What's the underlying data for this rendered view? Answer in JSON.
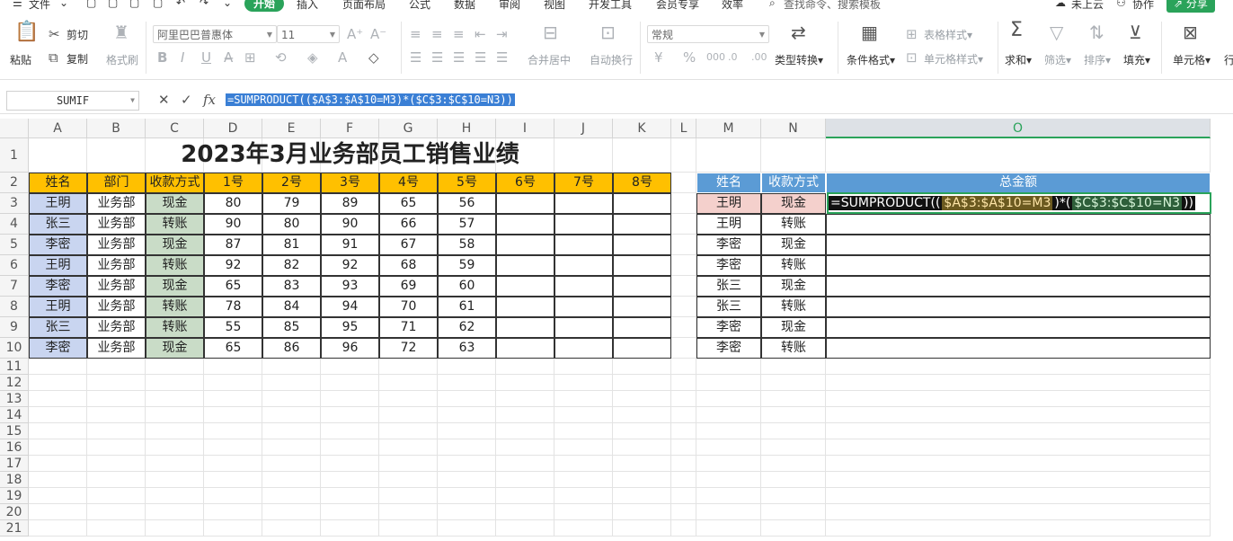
{
  "menubar": {
    "file": "文件",
    "tabs": [
      "开始",
      "插入",
      "页面布局",
      "公式",
      "数据",
      "审阅",
      "视图",
      "开发工具",
      "会员专享",
      "效率"
    ],
    "active_tab": "开始",
    "search_placeholder": "查找命令、搜索模板",
    "cloud": "未上云",
    "collab": "协作",
    "share": "分享"
  },
  "ribbon": {
    "paste": "粘贴",
    "cut": "剪切",
    "copy": "复制",
    "format_painter": "格式刷",
    "font_name": "阿里巴巴普惠体",
    "font_size": "11",
    "merge_center": "合并居中",
    "auto_wrap": "自动换行",
    "number_format": "常规",
    "type_convert": "类型转换",
    "cond_format": "条件格式",
    "table_style": "表格样式",
    "cell_style": "单元格样式",
    "sum": "求和",
    "filter": "筛选",
    "sort": "排序",
    "fill": "填充",
    "cell": "单元格",
    "row_col": "行"
  },
  "formula_bar": {
    "name_box": "SUMIF",
    "formula": "=SUMPRODUCT(($A$3:$A$10=M3)*($C$3:$C$10=N3))"
  },
  "columns": [
    "A",
    "B",
    "C",
    "D",
    "E",
    "F",
    "G",
    "H",
    "I",
    "J",
    "K",
    "L",
    "M",
    "N",
    "O"
  ],
  "rows": [
    "1",
    "2",
    "3",
    "4",
    "5",
    "6",
    "7",
    "8",
    "9",
    "10",
    "11",
    "12",
    "13",
    "14",
    "15",
    "16",
    "17",
    "18",
    "19",
    "20",
    "21"
  ],
  "sheet": {
    "title": "2023年3月业务部员工销售业绩",
    "headers": [
      "姓名",
      "部门",
      "收款方式",
      "1号",
      "2号",
      "3号",
      "4号",
      "5号",
      "6号",
      "7号",
      "8号"
    ],
    "data": [
      [
        "王明",
        "业务部",
        "现金",
        "80",
        "79",
        "89",
        "65",
        "56"
      ],
      [
        "张三",
        "业务部",
        "转账",
        "90",
        "80",
        "90",
        "66",
        "57"
      ],
      [
        "李密",
        "业务部",
        "现金",
        "87",
        "81",
        "91",
        "67",
        "58"
      ],
      [
        "王明",
        "业务部",
        "转账",
        "92",
        "82",
        "92",
        "68",
        "59"
      ],
      [
        "李密",
        "业务部",
        "现金",
        "65",
        "83",
        "93",
        "69",
        "60"
      ],
      [
        "王明",
        "业务部",
        "转账",
        "78",
        "84",
        "94",
        "70",
        "61"
      ],
      [
        "张三",
        "业务部",
        "转账",
        "55",
        "85",
        "95",
        "71",
        "62"
      ],
      [
        "李密",
        "业务部",
        "现金",
        "65",
        "86",
        "96",
        "72",
        "63"
      ]
    ]
  },
  "summary": {
    "headers": [
      "姓名",
      "收款方式",
      "总金额"
    ],
    "rows": [
      [
        "王明",
        "现金"
      ],
      [
        "王明",
        "转账"
      ],
      [
        "李密",
        "现金"
      ],
      [
        "李密",
        "转账"
      ],
      [
        "张三",
        "现金"
      ],
      [
        "张三",
        "转账"
      ],
      [
        "李密",
        "现金"
      ],
      [
        "李密",
        "转账"
      ]
    ],
    "editing_prefix": "=SUMPRODUCT((",
    "editing_ref1": "$A$3:$A$10=M3",
    "editing_mid": ")*(",
    "editing_ref2": "$C$3:$C$10=N3",
    "editing_suffix": "))"
  },
  "colors": {
    "accent": "#2aa35a",
    "header_yellow": "#ffc000",
    "header_blue": "#5b9bd5",
    "range_a": "#c9d5f0",
    "range_c": "#c9dcc7",
    "range_m": "#f4d0cc"
  }
}
